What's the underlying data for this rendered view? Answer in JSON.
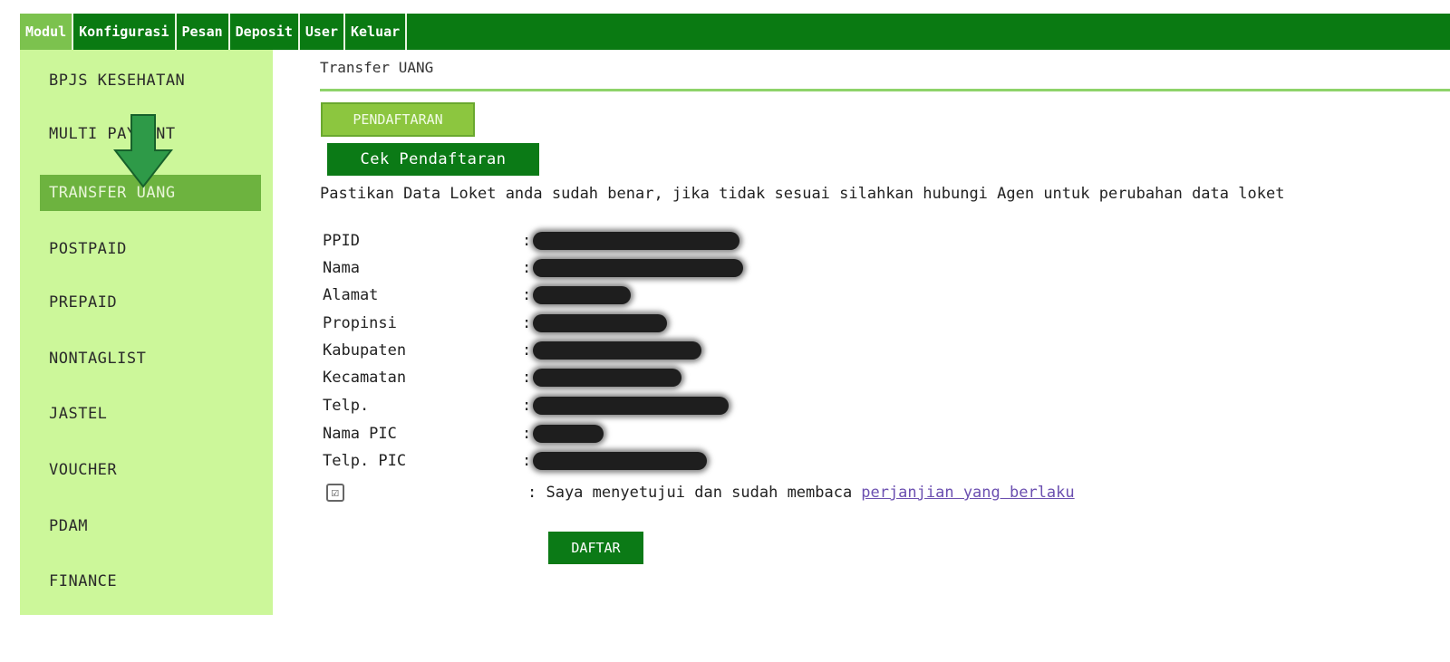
{
  "topnav": {
    "items": [
      {
        "label": "Modul",
        "active": true
      },
      {
        "label": "Konfigurasi",
        "active": false
      },
      {
        "label": "Pesan",
        "active": false
      },
      {
        "label": "Deposit",
        "active": false
      },
      {
        "label": "User",
        "active": false
      },
      {
        "label": "Keluar",
        "active": false
      }
    ]
  },
  "sidebar": {
    "items": [
      {
        "label": "BPJS KESEHATAN",
        "active": false
      },
      {
        "label": "MULTI PAYMENT",
        "active": false
      },
      {
        "label": "TRANSFER UANG",
        "active": true
      },
      {
        "label": "POSTPAID",
        "active": false
      },
      {
        "label": "PREPAID",
        "active": false
      },
      {
        "label": "NONTAGLIST",
        "active": false
      },
      {
        "label": "JASTEL",
        "active": false
      },
      {
        "label": "VOUCHER",
        "active": false
      },
      {
        "label": "PDAM",
        "active": false
      },
      {
        "label": "FINANCE",
        "active": false
      }
    ]
  },
  "main": {
    "title": "Transfer UANG",
    "pendaftaran_label": "PENDAFTARAN",
    "cek_label": "Cek Pendaftaran",
    "info_text": "Pastikan Data Loket anda sudah benar, jika tidak sesuai silahkan hubungi Agen untuk perubahan data loket",
    "fields": [
      {
        "label": "PPID",
        "colon": ":"
      },
      {
        "label": "Nama",
        "colon": ":"
      },
      {
        "label": "Alamat",
        "colon": ":"
      },
      {
        "label": "Propinsi",
        "colon": ":"
      },
      {
        "label": "Kabupaten",
        "colon": ":"
      },
      {
        "label": "Kecamatan",
        "colon": ":"
      },
      {
        "label": "Telp.",
        "colon": ":"
      },
      {
        "label": "Nama PIC",
        "colon": ":"
      },
      {
        "label": "Telp. PIC",
        "colon": ":"
      }
    ],
    "agree": {
      "checked": true,
      "check_glyph": "☑",
      "text": ": Saya menyetujui dan sudah membaca",
      "link": "perjanjian yang berlaku"
    },
    "daftar_label": "DAFTAR"
  },
  "colors": {
    "topbar": "#0a7a12",
    "sidebar": "#ccf79a",
    "active_item": "#6db33f",
    "button_dark": "#0b7a16",
    "button_light": "#8cc63f",
    "link": "#6b4fb0"
  },
  "icons": {
    "sidebar_arrow": "arrow-down-icon",
    "checkbox": "checkbox-checked-icon"
  }
}
